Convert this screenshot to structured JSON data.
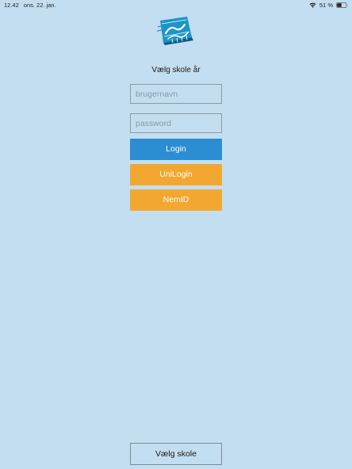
{
  "status_bar": {
    "time": "12.42",
    "date": "ons. 22. jan.",
    "battery_percent": "51 %",
    "battery_level": 0.51,
    "icons": [
      "wifi-icon",
      "battery-icon"
    ]
  },
  "logo": {
    "icon": "skoleplan-logo",
    "colors": {
      "primary": "#1c95c9",
      "dark": "#0d5f86"
    }
  },
  "subtitle": "Vælg skole år",
  "form": {
    "username_placeholder": "brugernavn",
    "password_placeholder": "password",
    "login_label": "Login",
    "unilogin_label": "UniLogin",
    "nemid_label": "NemID"
  },
  "footer": {
    "choose_school_label": "Vælg skole"
  },
  "colors": {
    "background": "#c3def0",
    "login_button": "#2b8ed3",
    "alt_login_button": "#f2a830"
  }
}
